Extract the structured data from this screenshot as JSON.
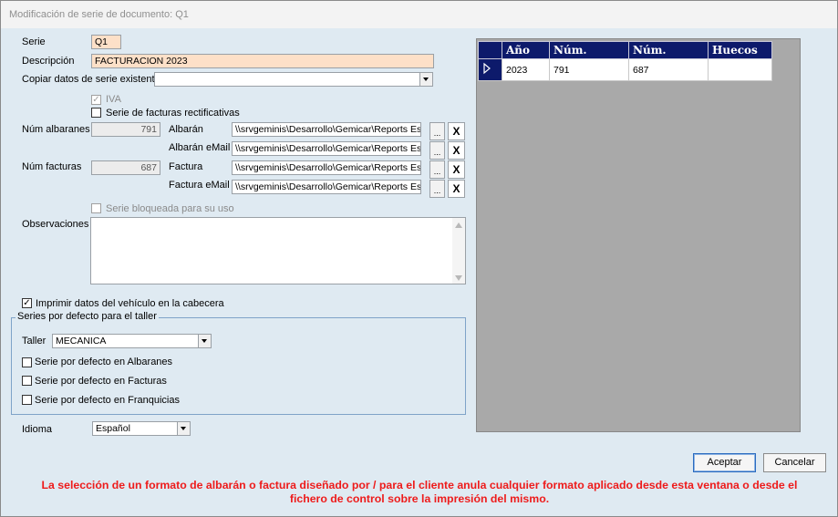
{
  "window": {
    "title": "Modificación de serie de documento: Q1"
  },
  "form": {
    "serie_label": "Serie",
    "serie_value": "Q1",
    "descripcion_label": "Descripción",
    "descripcion_value": "FACTURACION 2023",
    "copiar_label": "Copiar datos de serie existente",
    "copiar_value": "",
    "iva_label": "IVA",
    "iva_checked": true,
    "rectificativas_label": "Serie de facturas rectificativas",
    "num_albaranes_label": "Núm albaranes",
    "num_albaranes_value": "791",
    "num_facturas_label": "Núm facturas",
    "num_facturas_value": "687",
    "albaran_label": "Albarán",
    "albaran_path": "\\\\srvgeminis\\Desarrollo\\Gemicar\\Reports Estanda",
    "albaran_email_label": "Albarán eMail",
    "albaran_email_path": "\\\\srvgeminis\\Desarrollo\\Gemicar\\Reports Estanda",
    "factura_label": "Factura",
    "factura_path": "\\\\srvgeminis\\Desarrollo\\Gemicar\\Reports Estanda",
    "factura_email_label": "Factura eMail",
    "factura_email_path": "\\\\srvgeminis\\Desarrollo\\Gemicar\\Reports Estanda",
    "browse_label": "...",
    "clear_label": "X",
    "bloqueada_label": "Serie bloqueada para su uso",
    "observaciones_label": "Observaciones",
    "observaciones_value": "",
    "imprimir_label": "Imprimir datos del vehículo en la cabecera",
    "imprimir_checked": true,
    "idioma_label": "Idioma",
    "idioma_value": "Español"
  },
  "taller_group": {
    "caption": "Series por defecto para el taller",
    "taller_label": "Taller",
    "taller_value": "MECANICA",
    "albaranes_label": "Serie por defecto en Albaranes",
    "facturas_label": "Serie por defecto en Facturas",
    "franquicias_label": "Serie por defecto en Franquicias"
  },
  "grid": {
    "headers": [
      "Año",
      "Núm.",
      "Núm.",
      "Huecos"
    ],
    "rows": [
      {
        "anio": "2023",
        "num1": "791",
        "num2": "687",
        "huecos": ""
      }
    ]
  },
  "buttons": {
    "accept": "Aceptar",
    "cancel": "Cancelar"
  },
  "warning": "La selección de un formato de albarán o factura diseñado por / para el cliente anula cualquier formato aplicado desde esta ventana o desde el fichero de control sobre la impresión del mismo.",
  "colors": {
    "accent_header": "#0d1a6b",
    "warning": "#ee1b1b",
    "form_bg": "#dfeaf2",
    "highlight_input": "#fde0c8"
  }
}
